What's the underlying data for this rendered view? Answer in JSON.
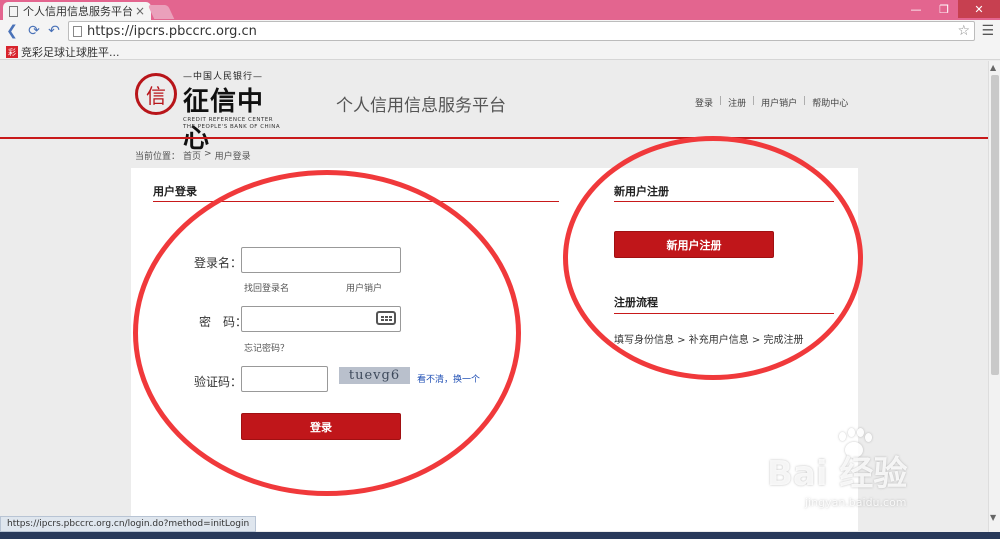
{
  "browser": {
    "tab_title": "个人信用信息服务平台",
    "tab_close": "×",
    "url": "https://ipcrs.pbccrc.org.cn",
    "bookmark": "竞彩足球让球胜平...",
    "bookmark_icon_text": "彩",
    "status_url": "https://ipcrs.pbccrc.org.cn/login.do?method=initLogin",
    "win_min": "—",
    "win_restore": "❐",
    "win_close": "✕"
  },
  "header": {
    "logo_top": "—中国人民银行—",
    "logo_main": "征信中心",
    "logo_en_1": "CREDIT REFERENCE CENTER",
    "logo_en_2": "THE PEOPLE'S BANK OF CHINA",
    "site_title": "个人信用信息服务平台",
    "nav": [
      "登录",
      "注册",
      "用户销户",
      "帮助中心"
    ],
    "nav_sep": "|"
  },
  "breadcrumb": {
    "label": "当前位置：",
    "home": "首页",
    "sep": ">",
    "current": "用户登录"
  },
  "login": {
    "title": "用户登录",
    "username_label": "登录名：",
    "find_username": "找回登录名",
    "cancel_account": "用户销户",
    "password_label": "密　码：",
    "forgot_password": "忘记密码？",
    "captcha_label": "验证码：",
    "captcha_text": "tuevg6",
    "captcha_refresh": "看不清，换一个",
    "login_button": "登录"
  },
  "register": {
    "title": "新用户注册",
    "button": "新用户注册",
    "flow_title": "注册流程",
    "flow_steps": "填写身份信息 > 补充用户信息 > 完成注册"
  },
  "watermark": {
    "brand": "Bai  经验",
    "url": "jingyan.baidu.com"
  },
  "colors": {
    "brand_red": "#c0161a",
    "annotation_red": "#f0393b",
    "tab_bar": "#e3658f"
  }
}
